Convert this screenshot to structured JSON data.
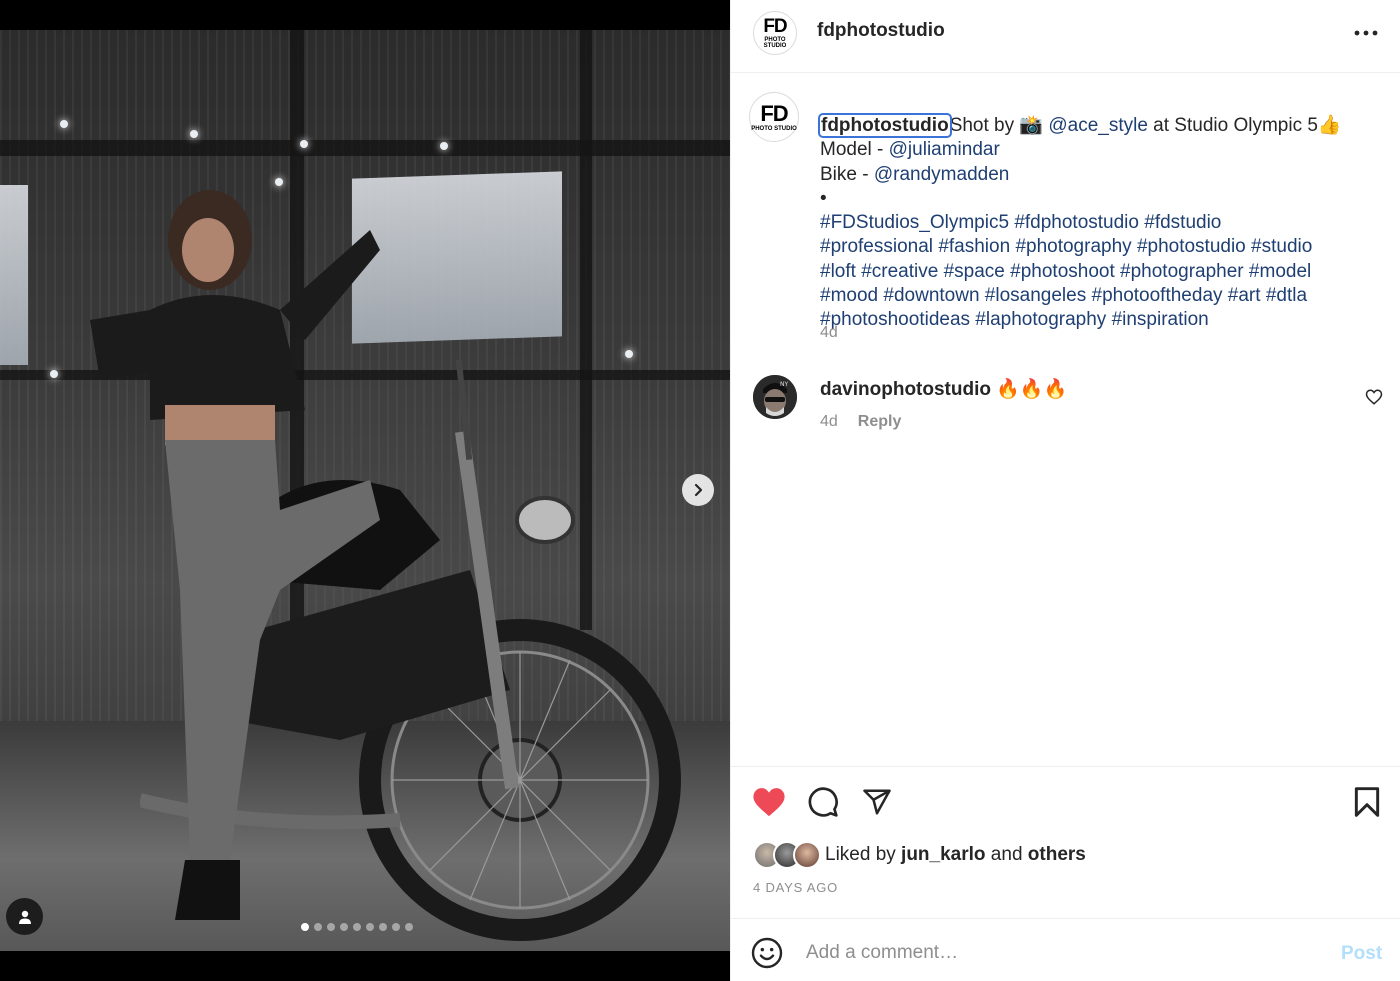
{
  "post": {
    "username": "fdphotostudio",
    "avatar_text_big": "FD",
    "avatar_text_small": "PHOTO STUDIO",
    "more_icon": "more-horizontal-icon"
  },
  "media": {
    "carousel_count": 9,
    "carousel_active": 1,
    "next_icon": "chevron-right-icon",
    "tags_icon": "user-tag-icon"
  },
  "caption": {
    "username": "fdphotostudio",
    "lines": [
      {
        "segments": [
          {
            "type": "text",
            "text": "Shot by 📸 "
          },
          {
            "type": "mention",
            "text": "@ace_style"
          },
          {
            "type": "text",
            "text": " at Studio Olympic 5👍"
          }
        ]
      },
      {
        "segments": [
          {
            "type": "text",
            "text": "Model - "
          },
          {
            "type": "mention",
            "text": "@juliamindar"
          }
        ]
      },
      {
        "segments": [
          {
            "type": "text",
            "text": "Bike - "
          },
          {
            "type": "mention",
            "text": "@randymadden"
          }
        ]
      },
      {
        "segments": [
          {
            "type": "text",
            "text": "•"
          }
        ]
      },
      {
        "segments": [
          {
            "type": "hashtag",
            "text": "#FDStudios_Olympic5"
          },
          {
            "type": "text",
            "text": " "
          },
          {
            "type": "hashtag",
            "text": "#fdphotostudio"
          },
          {
            "type": "text",
            "text": " "
          },
          {
            "type": "hashtag",
            "text": "#fdstudio"
          }
        ]
      },
      {
        "segments": [
          {
            "type": "hashtag",
            "text": "#professional"
          },
          {
            "type": "text",
            "text": " "
          },
          {
            "type": "hashtag",
            "text": "#fashion"
          },
          {
            "type": "text",
            "text": " "
          },
          {
            "type": "hashtag",
            "text": "#photography"
          },
          {
            "type": "text",
            "text": " "
          },
          {
            "type": "hashtag",
            "text": "#photostudio"
          },
          {
            "type": "text",
            "text": " "
          },
          {
            "type": "hashtag",
            "text": "#studio"
          }
        ]
      },
      {
        "segments": [
          {
            "type": "hashtag",
            "text": "#loft"
          },
          {
            "type": "text",
            "text": " "
          },
          {
            "type": "hashtag",
            "text": "#creative"
          },
          {
            "type": "text",
            "text": " "
          },
          {
            "type": "hashtag",
            "text": "#space"
          },
          {
            "type": "text",
            "text": " "
          },
          {
            "type": "hashtag",
            "text": "#photoshoot"
          },
          {
            "type": "text",
            "text": " "
          },
          {
            "type": "hashtag",
            "text": "#photographer"
          },
          {
            "type": "text",
            "text": " "
          },
          {
            "type": "hashtag",
            "text": "#model"
          }
        ]
      },
      {
        "segments": [
          {
            "type": "hashtag",
            "text": "#mood"
          },
          {
            "type": "text",
            "text": " "
          },
          {
            "type": "hashtag",
            "text": "#downtown"
          },
          {
            "type": "text",
            "text": " "
          },
          {
            "type": "hashtag",
            "text": "#losangeles"
          },
          {
            "type": "text",
            "text": " "
          },
          {
            "type": "hashtag",
            "text": "#photooftheday"
          },
          {
            "type": "text",
            "text": " "
          },
          {
            "type": "hashtag",
            "text": "#art"
          },
          {
            "type": "text",
            "text": " "
          },
          {
            "type": "hashtag",
            "text": "#dtla"
          }
        ]
      },
      {
        "segments": [
          {
            "type": "hashtag",
            "text": "#photoshootideas"
          },
          {
            "type": "text",
            "text": " "
          },
          {
            "type": "hashtag",
            "text": "#laphotography"
          },
          {
            "type": "text",
            "text": " "
          },
          {
            "type": "hashtag",
            "text": "#inspiration"
          }
        ]
      }
    ],
    "time": "4d"
  },
  "comments": [
    {
      "username": "davinophotostudio",
      "text": "🔥🔥🔥",
      "time": "4d",
      "reply_label": "Reply",
      "like_icon": "heart-outline-icon"
    }
  ],
  "actions": {
    "like_icon": "heart-filled-icon",
    "like_color": "#ed4956",
    "comment_icon": "comment-icon",
    "share_icon": "send-icon",
    "save_icon": "bookmark-icon"
  },
  "likes": {
    "prefix": "Liked by ",
    "user": "jun_karlo",
    "middle": " and ",
    "others": "others"
  },
  "post_date": "4 DAYS AGO",
  "add_comment": {
    "placeholder": "Add a comment…",
    "post_label": "Post",
    "emoji_icon": "emoji-smile-icon",
    "post_color": "#b2dffc"
  }
}
